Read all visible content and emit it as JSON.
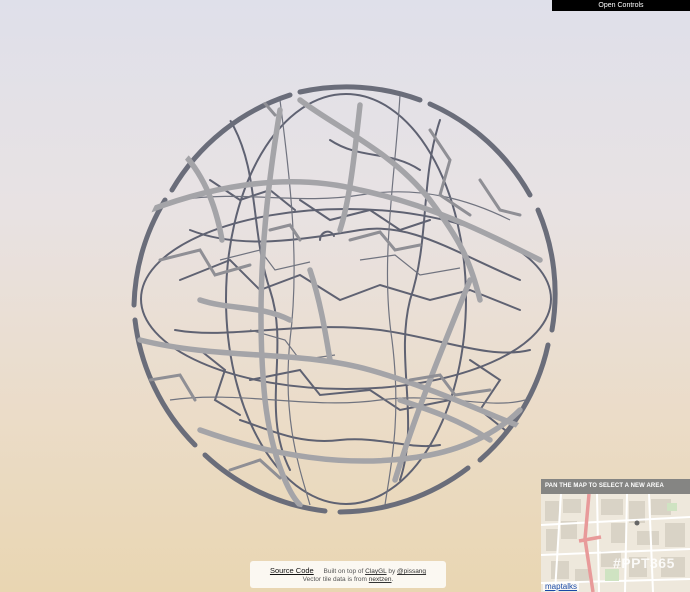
{
  "controls": {
    "open_label": "Open Controls"
  },
  "footer": {
    "source_code": "Source Code",
    "built_on": "Built on top of",
    "claygl": "ClayGL",
    "by": "by",
    "author": "@pissang",
    "vector_tile": "Vector tile data is from",
    "nextzen": "nextzen"
  },
  "minimap": {
    "title": "PAN THE MAP TO SELECT A NEW AREA",
    "tag": "#PPT365",
    "brand": "maptalks"
  },
  "colors": {
    "wire_light": "#a3a3a6",
    "wire_dark": "#5d6070",
    "controls_bg": "#000000",
    "link": "#1a4aa5"
  }
}
